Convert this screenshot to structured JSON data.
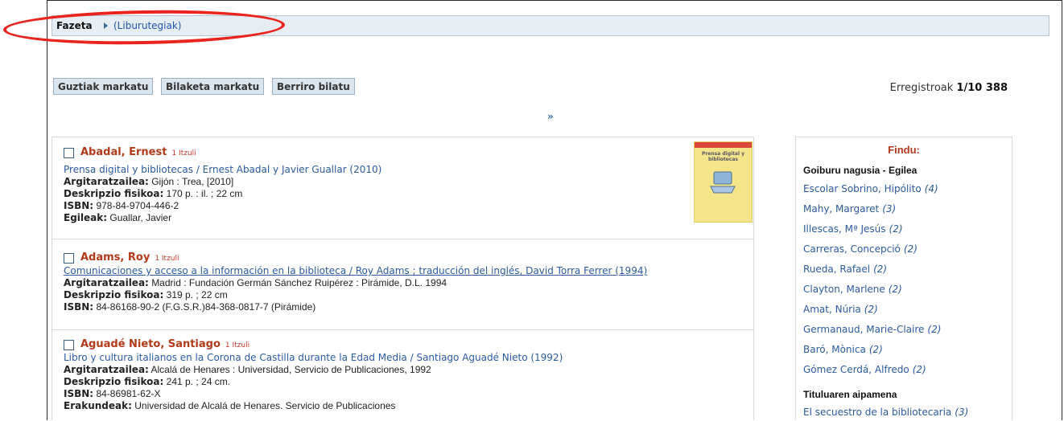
{
  "facet": {
    "label": "Fazeta",
    "link": "(Liburutegiak)"
  },
  "toolbar": {
    "mark_all": "Guztiak markatu",
    "mark_search": "Bilaketa markatu",
    "search_again": "Berriro bilatu"
  },
  "records": {
    "label": "Erregistroak",
    "range": "1/10 388"
  },
  "pager": {
    "next": "»"
  },
  "results": [
    {
      "author": "Abadal, Ernest",
      "itzuli": "1 Itzuli",
      "title": "Prensa digital y bibliotecas / Ernest Abadal y Javier Guallar (2010)",
      "fields": [
        {
          "label": "Argitaratzailea:",
          "value": "Gijón : Trea, [2010]"
        },
        {
          "label": "Deskripzio fisikoa:",
          "value": "170 p. : il. ; 22 cm"
        },
        {
          "label": "ISBN:",
          "value": "978-84-9704-446-2"
        },
        {
          "label": "Egileak:",
          "value": "Guallar, Javier"
        }
      ],
      "cover_text": "Prensa digital y bibliotecas"
    },
    {
      "author": "Adams, Roy",
      "itzuli": "1 Itzuli",
      "title": "Comunicaciones y acceso a la información en la biblioteca / Roy Adams ; traducción del inglés, David Torra Ferrer (1994)",
      "fields": [
        {
          "label": "Argitaratzailea:",
          "value": "Madrid : Fundación Germán Sánchez Ruipérez : Pirámide, D.L. 1994"
        },
        {
          "label": "Deskripzio fisikoa:",
          "value": "319 p. ; 22 cm"
        },
        {
          "label": "ISBN:",
          "value": "84-86168-90-2 (F.G.S.R.)84-368-0817-7 (Pirámide)"
        }
      ]
    },
    {
      "author": "Aguadé Nieto, Santiago",
      "itzuli": "1 Itzuli",
      "title": "Libro y cultura italianos en la Corona de Castilla durante la Edad Media / Santiago Aguadé Nieto (1992)",
      "fields": [
        {
          "label": "Argitaratzailea:",
          "value": "Alcalá de Henares : Universidad, Servicio de Publicaciones, 1992"
        },
        {
          "label": "Deskripzio fisikoa:",
          "value": "241 p. ; 24 cm."
        },
        {
          "label": "ISBN:",
          "value": "84-86981-62-X"
        },
        {
          "label": "Erakundeak:",
          "value": "Universidad de Alcalá de Henares. Servicio de Publicaciones"
        }
      ]
    }
  ],
  "refine": {
    "title": "Findu:",
    "section1": "Goiburu nagusia - Egilea",
    "authors": [
      {
        "name": "Escolar Sobrino, Hipólito",
        "count": "(4)"
      },
      {
        "name": "Mahy, Margaret",
        "count": "(3)"
      },
      {
        "name": "Illescas, Mª Jesús",
        "count": "(2)"
      },
      {
        "name": "Carreras, Concepció",
        "count": "(2)"
      },
      {
        "name": "Rueda, Rafael",
        "count": "(2)"
      },
      {
        "name": "Clayton, Marlene",
        "count": "(2)"
      },
      {
        "name": "Amat, Núria",
        "count": "(2)"
      },
      {
        "name": "Germanaud, Marie-Claire",
        "count": "(2)"
      },
      {
        "name": "Baró, Mònica",
        "count": "(2)"
      },
      {
        "name": "Gómez Cerdá, Alfredo",
        "count": "(2)"
      }
    ],
    "section2": "Tituluaren aipamena",
    "titles": [
      {
        "name": "El secuestro de la bibliotecaria",
        "count": "(3)"
      }
    ]
  },
  "colors": {
    "author": "#b23a1a",
    "link": "#2c5aa0",
    "highlight": "#e8241c"
  }
}
